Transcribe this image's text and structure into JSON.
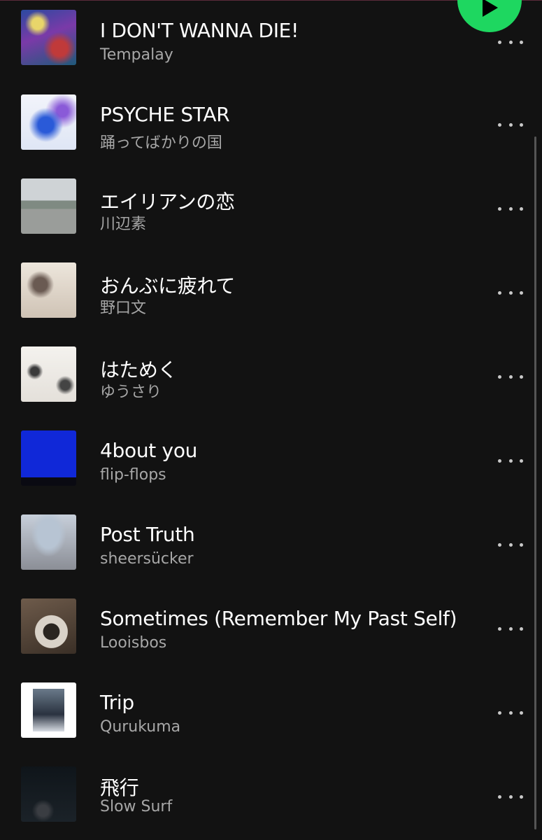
{
  "tracks": [
    {
      "title": "I DON'T WANNA DIE!",
      "artist": "Tempalay"
    },
    {
      "title": "PSYCHE STAR",
      "artist": "踊ってばかりの国"
    },
    {
      "title": "エイリアンの恋",
      "artist": "川辺素"
    },
    {
      "title": "おんぶに疲れて",
      "artist": "野口文"
    },
    {
      "title": "はためく",
      "artist": "ゆうさり"
    },
    {
      "title": "4bout you",
      "artist": "flip-flops"
    },
    {
      "title": "Post Truth",
      "artist": "sheersücker"
    },
    {
      "title": "Sometimes (Remember My Past Self)",
      "artist": "Looisbos"
    },
    {
      "title": "Trip",
      "artist": "Qurukuma"
    },
    {
      "title": "飛行",
      "artist": "Slow Surf"
    }
  ],
  "icons": {
    "play": "play-icon",
    "more": "more-options-icon"
  },
  "colors": {
    "background": "#121212",
    "accent": "#1ed760",
    "title_text": "#ffffff",
    "subtitle_text": "#a7a7a7"
  }
}
